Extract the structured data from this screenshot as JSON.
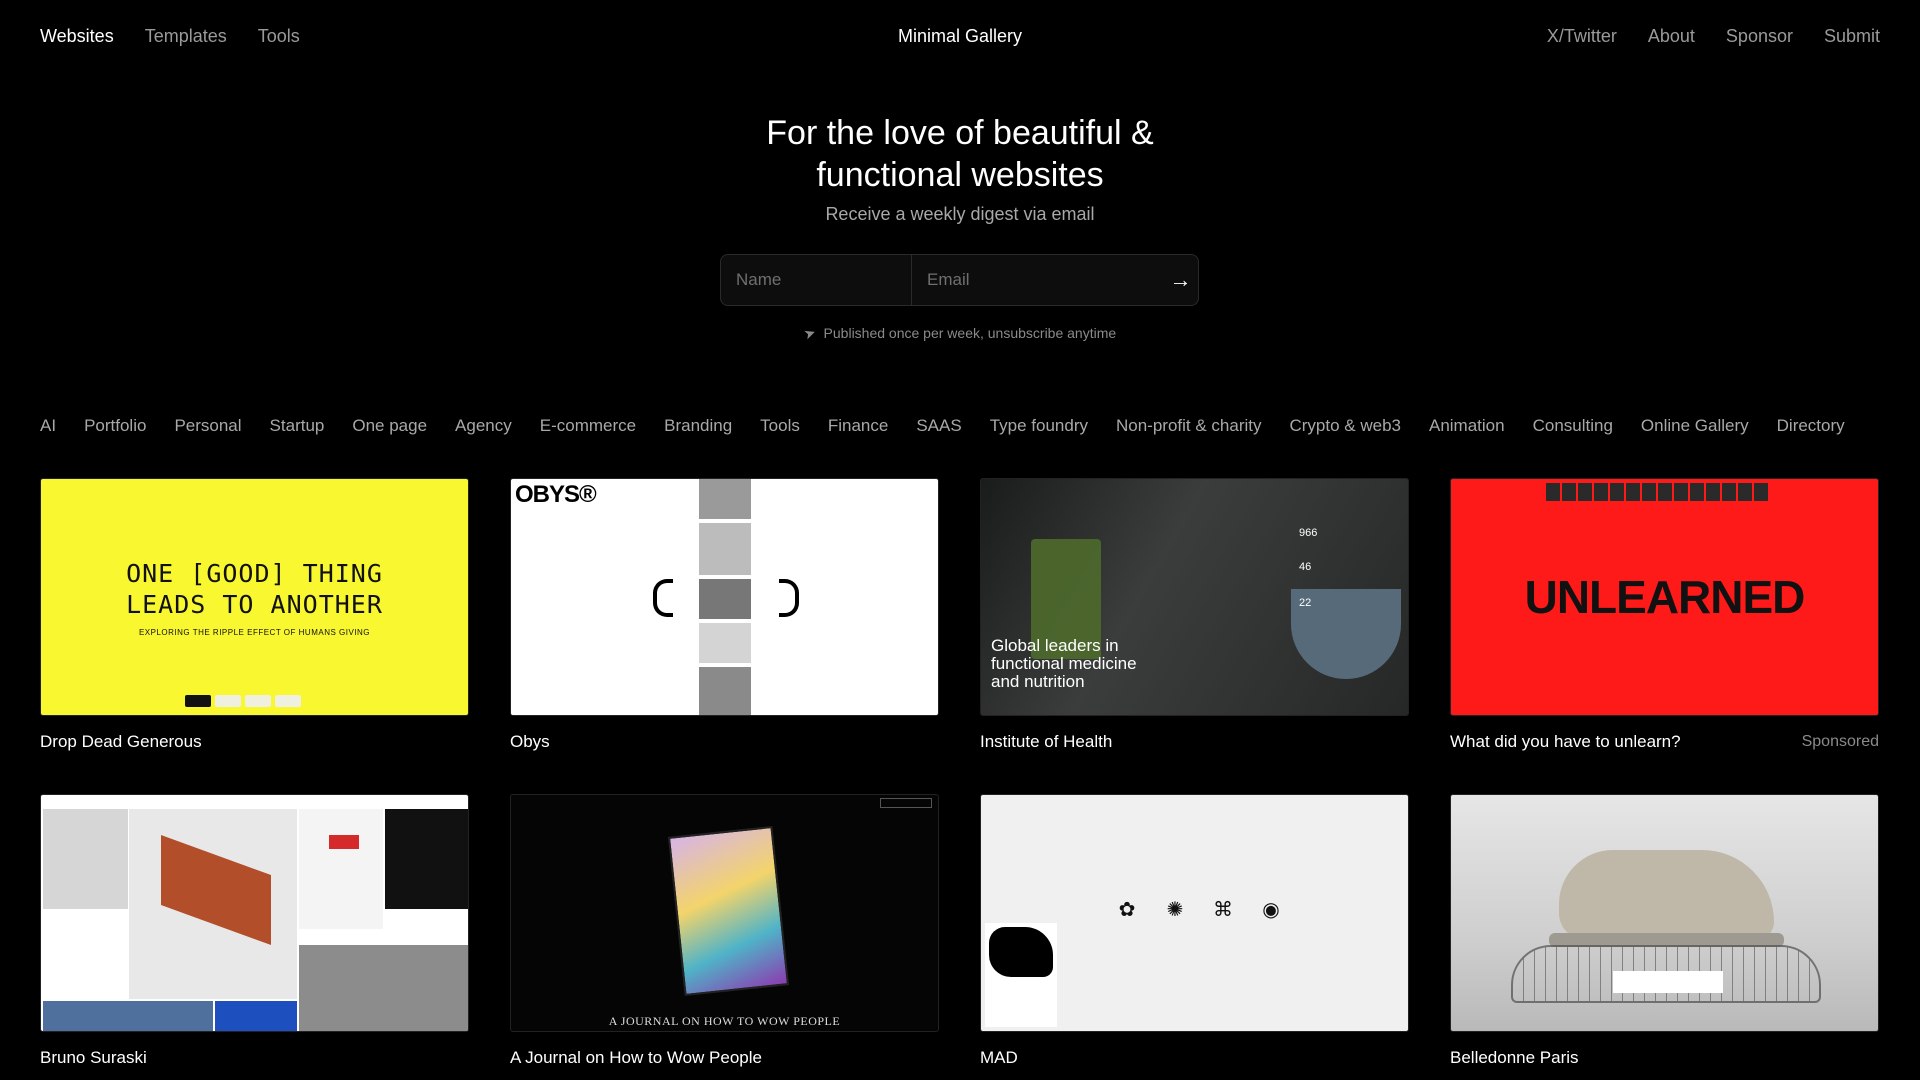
{
  "nav": {
    "left": [
      "Websites",
      "Templates",
      "Tools"
    ],
    "brand": "Minimal Gallery",
    "right": [
      "X/Twitter",
      "About",
      "Sponsor",
      "Submit"
    ]
  },
  "hero": {
    "title": "For the love of beautiful & functional websites",
    "subtitle": "Receive a weekly digest via email"
  },
  "form": {
    "name_placeholder": "Name",
    "email_placeholder": "Email",
    "submit_icon": "arrow-right-icon"
  },
  "note": {
    "icon": "paper-plane-icon",
    "text": "Published once per week, unsubscribe anytime"
  },
  "categories": [
    "AI",
    "Portfolio",
    "Personal",
    "Startup",
    "One page",
    "Agency",
    "E-commerce",
    "Branding",
    "Tools",
    "Finance",
    "SAAS",
    "Type foundry",
    "Non-profit & charity",
    "Crypto & web3",
    "Animation",
    "Consulting",
    "Online Gallery",
    "Directory"
  ],
  "cards": [
    {
      "title": "Drop Dead Generous",
      "sponsored": "",
      "thumb": {
        "big": "ONE [GOOD] THING\nLEADS TO ANOTHER",
        "small": "EXPLORING THE RIPPLE EFFECT OF HUMANS GIVING"
      }
    },
    {
      "title": "Obys",
      "sponsored": "",
      "thumb": {
        "logo": "OBYS®"
      }
    },
    {
      "title": "Institute of Health",
      "sponsored": "",
      "thumb": {
        "text": "Global leaders in functional medicine and nutrition",
        "nums": [
          "966",
          "46",
          "22"
        ]
      }
    },
    {
      "title": "What did you have to unlearn?",
      "sponsored": "Sponsored",
      "thumb": {
        "big": "UNLEARNED"
      }
    },
    {
      "title": "Bruno Suraski",
      "sponsored": "",
      "thumb": {}
    },
    {
      "title": "A Journal on How to Wow People",
      "sponsored": "",
      "thumb": {
        "foot": "A JOURNAL ON HOW TO WOW PEOPLE"
      }
    },
    {
      "title": "MAD",
      "sponsored": "",
      "thumb": {}
    },
    {
      "title": "Belledonne Paris",
      "sponsored": "",
      "thumb": {}
    }
  ]
}
